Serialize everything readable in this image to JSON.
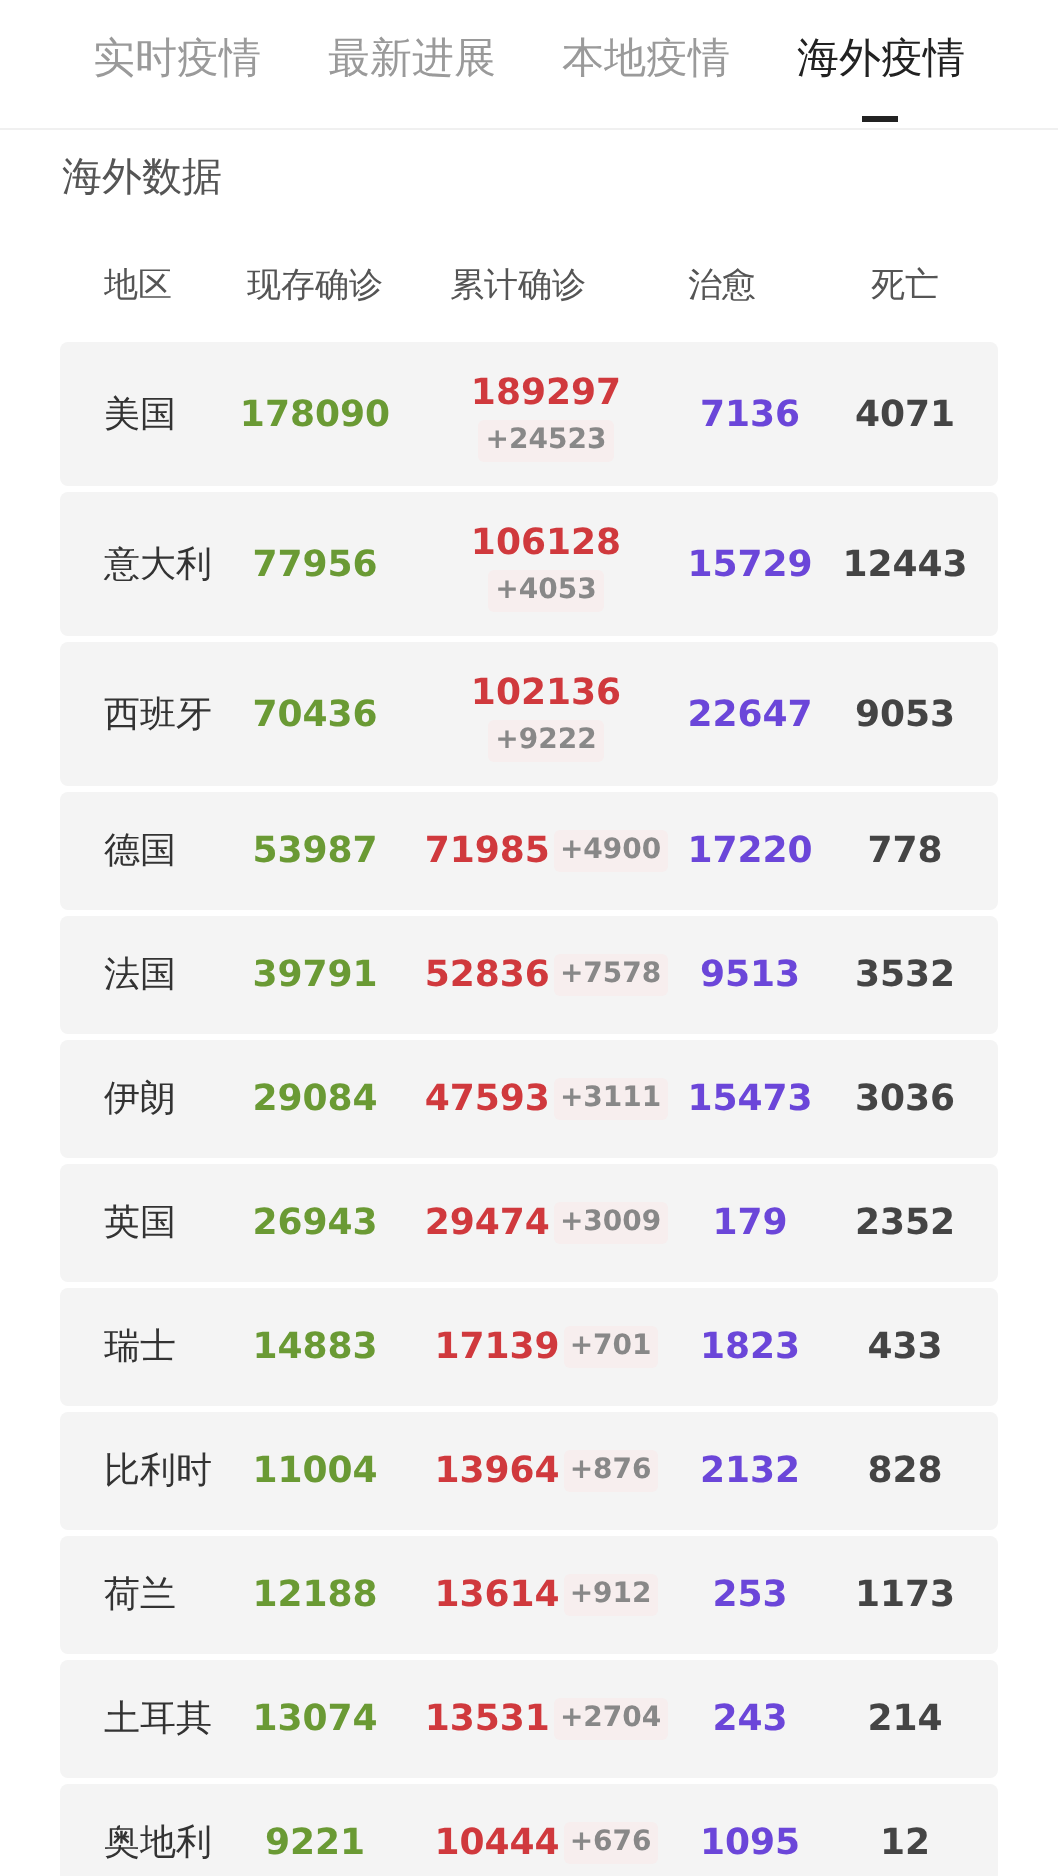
{
  "tabs": [
    {
      "label": "实时疫情",
      "selected": false
    },
    {
      "label": "最新进展",
      "selected": false
    },
    {
      "label": "本地疫情",
      "selected": false
    },
    {
      "label": "海外疫情",
      "selected": true
    }
  ],
  "section_title": "海外数据",
  "table": {
    "columns": [
      "地区",
      "现存确诊",
      "累计确诊",
      "治愈",
      "死亡"
    ],
    "rows": [
      {
        "kind": "stacked",
        "region": "美国",
        "current": "178090",
        "total": "189297",
        "increase": "+24523",
        "cured": "7136",
        "deaths": "4071"
      },
      {
        "kind": "stacked",
        "region": "意大利",
        "current": "77956",
        "total": "106128",
        "increase": "+4053",
        "cured": "15729",
        "deaths": "12443"
      },
      {
        "kind": "stacked",
        "region": "西班牙",
        "current": "70436",
        "total": "102136",
        "increase": "+9222",
        "cured": "22647",
        "deaths": "9053"
      },
      {
        "kind": "inline",
        "region": "德国",
        "current": "53987",
        "total": "71985",
        "increase": "+4900",
        "cured": "17220",
        "deaths": "778"
      },
      {
        "kind": "inline",
        "region": "法国",
        "current": "39791",
        "total": "52836",
        "increase": "+7578",
        "cured": "9513",
        "deaths": "3532"
      },
      {
        "kind": "inline",
        "region": "伊朗",
        "current": "29084",
        "total": "47593",
        "increase": "+3111",
        "cured": "15473",
        "deaths": "3036"
      },
      {
        "kind": "inline",
        "region": "英国",
        "current": "26943",
        "total": "29474",
        "increase": "+3009",
        "cured": "179",
        "deaths": "2352"
      },
      {
        "kind": "inline",
        "region": "瑞士",
        "current": "14883",
        "total": "17139",
        "increase": "+701",
        "cured": "1823",
        "deaths": "433"
      },
      {
        "kind": "inline",
        "region": "比利时",
        "current": "11004",
        "total": "13964",
        "increase": "+876",
        "cured": "2132",
        "deaths": "828"
      },
      {
        "kind": "inline",
        "region": "荷兰",
        "current": "12188",
        "total": "13614",
        "increase": "+912",
        "cured": "253",
        "deaths": "1173"
      },
      {
        "kind": "inline",
        "region": "土耳其",
        "current": "13074",
        "total": "13531",
        "increase": "+2704",
        "cured": "243",
        "deaths": "214"
      },
      {
        "kind": "inline",
        "region": "奥地利",
        "current": "9221",
        "total": "10444",
        "increase": "+676",
        "cured": "1095",
        "deaths": "12"
      }
    ]
  }
}
